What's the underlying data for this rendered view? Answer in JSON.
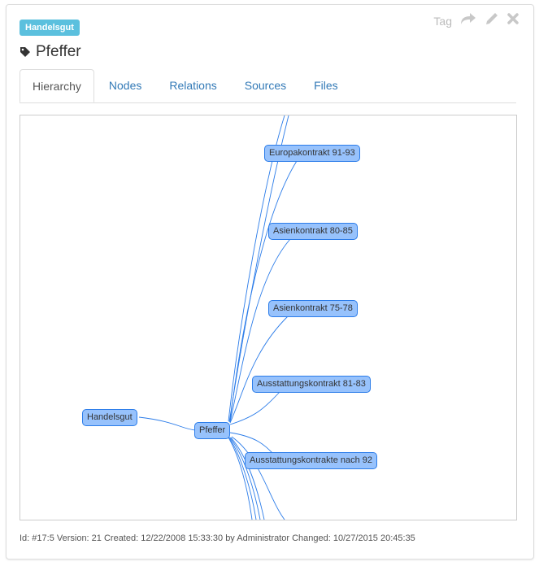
{
  "category_badge": "Handelsgut",
  "title": "Pfeffer",
  "toolbar": {
    "tag_label": "Tag",
    "icons": [
      "share-icon",
      "pencil-icon",
      "close-icon"
    ]
  },
  "tabs": [
    {
      "label": "Hierarchy",
      "active": true
    },
    {
      "label": "Nodes",
      "active": false
    },
    {
      "label": "Relations",
      "active": false
    },
    {
      "label": "Sources",
      "active": false
    },
    {
      "label": "Files",
      "active": false
    }
  ],
  "graph": {
    "nodes": [
      {
        "id": "handelsgut",
        "label": "Handelsgut"
      },
      {
        "id": "pfeffer",
        "label": "Pfeffer"
      },
      {
        "id": "europa",
        "label": "Europakontrakt 91-93"
      },
      {
        "id": "asien8085",
        "label": "Asienkontrakt 80-85"
      },
      {
        "id": "asien7578",
        "label": "Asienkontrakt 75-78"
      },
      {
        "id": "ausst8183",
        "label": "Ausstattungskontrakt 81-83"
      },
      {
        "id": "ausst92",
        "label": "Ausstattungskontrakte nach 92"
      }
    ],
    "edges": [
      [
        "handelsgut",
        "pfeffer"
      ],
      [
        "pfeffer",
        "europa"
      ],
      [
        "pfeffer",
        "asien8085"
      ],
      [
        "pfeffer",
        "asien7578"
      ],
      [
        "pfeffer",
        "ausst8183"
      ],
      [
        "pfeffer",
        "ausst92"
      ]
    ],
    "colors": {
      "node_fill": "#97c2fc",
      "node_border": "#2b7ce9",
      "edge": "#2b7ce9"
    }
  },
  "footer": {
    "text": "Id: #17:5 Version: 21 Created: 12/22/2008 15:33:30 by Administrator Changed: 10/27/2015 20:45:35"
  }
}
